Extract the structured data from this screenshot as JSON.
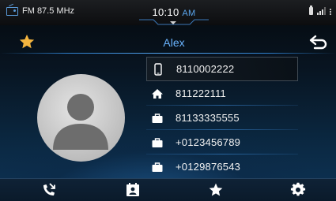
{
  "status": {
    "radio_label": "FM 87.5 MHz",
    "time": "10:10",
    "ampm": "AM"
  },
  "header": {
    "contact_name": "Alex",
    "favorite": true
  },
  "numbers": [
    {
      "type": "mobile",
      "icon": "mobile-phone-icon",
      "number": "8110002222",
      "selected": true
    },
    {
      "type": "home",
      "icon": "home-icon",
      "number": "811222111",
      "selected": false
    },
    {
      "type": "work",
      "icon": "briefcase-icon",
      "number": "81133335555",
      "selected": false
    },
    {
      "type": "work",
      "icon": "briefcase-icon",
      "number": "+0123456789",
      "selected": false
    },
    {
      "type": "work",
      "icon": "briefcase-icon",
      "number": "+0129876543",
      "selected": false
    }
  ],
  "bottom_bar": [
    {
      "icon": "call-history-icon"
    },
    {
      "icon": "contacts-icon"
    },
    {
      "icon": "favorites-star-icon"
    },
    {
      "icon": "settings-gear-icon"
    }
  ],
  "colors": {
    "accent": "#5aa6ee",
    "star": "#f4b53f",
    "name": "#6ab4ff"
  }
}
